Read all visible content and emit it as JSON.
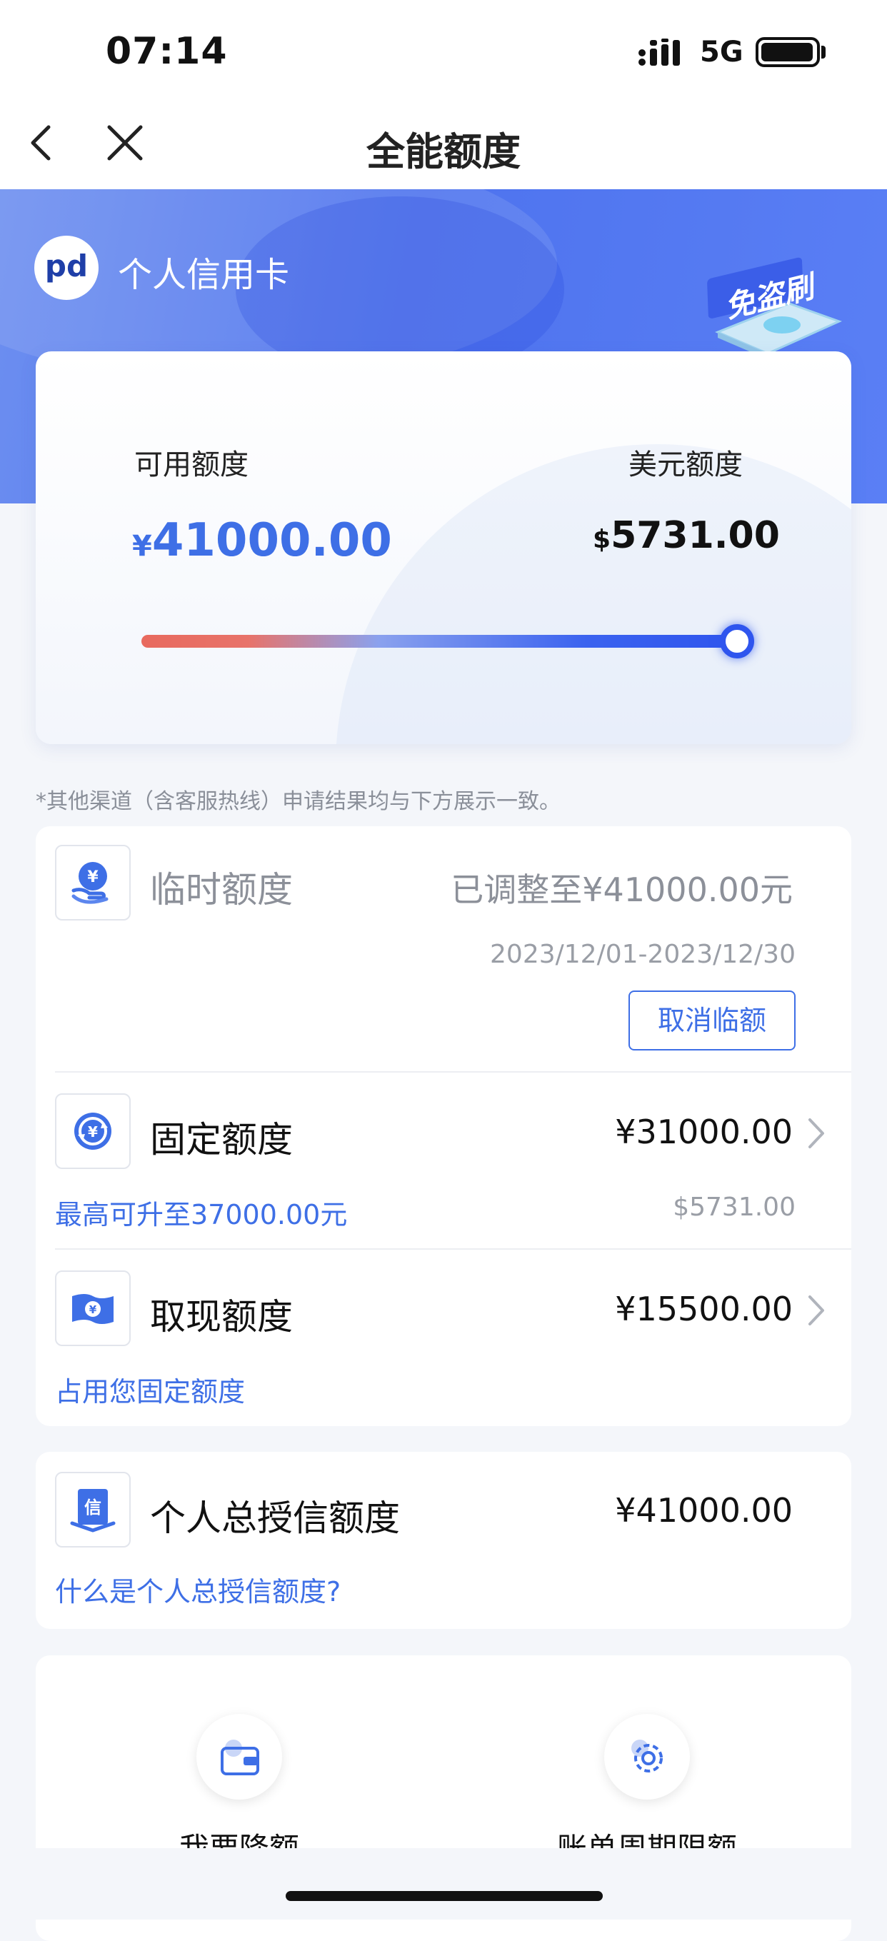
{
  "status_bar": {
    "time": "07:14",
    "network": "5G"
  },
  "nav": {
    "title": "全能额度"
  },
  "header": {
    "logo_text": "pd",
    "card_type": "个人信用卡",
    "badge_text": "免盗刷"
  },
  "limits": {
    "available_label": "可用额度",
    "available_symbol": "¥",
    "available_amount": "41000.00",
    "usd_label": "美元额度",
    "usd_symbol": "$",
    "usd_amount": "5731.00",
    "slider_level_percent": 100
  },
  "note": "*其他渠道（含客服热线）申请结果均与下方展示一致。",
  "temp_limit": {
    "title": "临时额度",
    "status": "已调整至¥41000.00元",
    "period": "2023/12/01-2023/12/30",
    "cancel_label": "取消临额"
  },
  "fixed_limit": {
    "title": "固定额度",
    "value": "¥31000.00",
    "sub_link": "最高可升至37000.00元",
    "sub_right": "$5731.00"
  },
  "cash_limit": {
    "title": "取现额度",
    "value": "¥15500.00",
    "sub_link": "占用您固定额度"
  },
  "total_credit": {
    "title": "个人总授信额度",
    "value": "¥41000.00",
    "sub_link": "什么是个人总授信额度?"
  },
  "actions": [
    {
      "label": "我要降额",
      "icon": "wallet-icon"
    },
    {
      "label": "账单周期限额",
      "icon": "gear-icon"
    }
  ],
  "icons": {
    "temp_limit": "yuan-hand-icon",
    "fixed_limit": "yuan-cycle-icon",
    "cash_limit": "cash-note-icon",
    "total_credit": "credit-doc-icon"
  },
  "colors": {
    "accent": "#3e6fe6",
    "banner": "#4e73ee",
    "slider_start": "#e86a5e",
    "slider_end": "#2f55ee"
  }
}
